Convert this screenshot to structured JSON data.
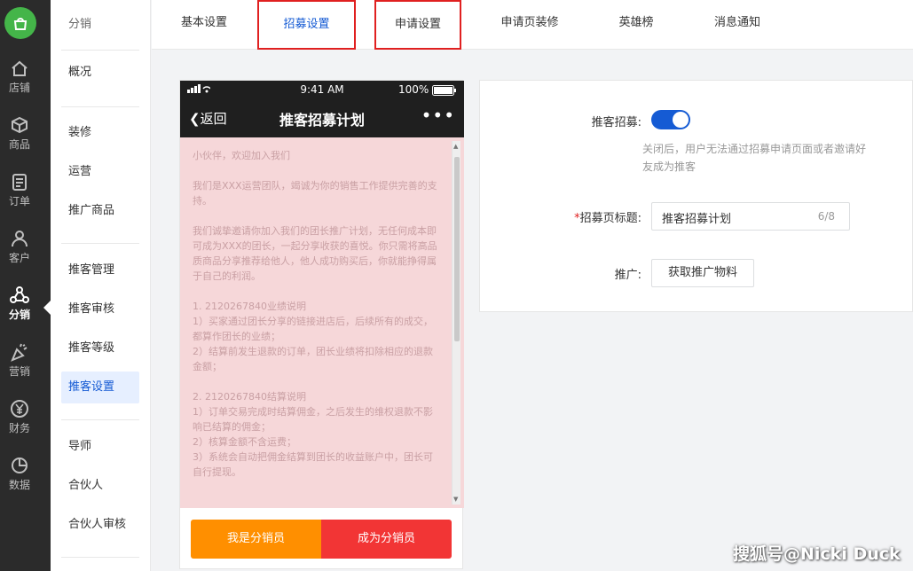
{
  "rail": {
    "items": [
      {
        "label": "店铺",
        "icon": "home-icon"
      },
      {
        "label": "商品",
        "icon": "cube-icon"
      },
      {
        "label": "订单",
        "icon": "order-icon"
      },
      {
        "label": "客户",
        "icon": "user-icon"
      },
      {
        "label": "分销",
        "icon": "distribution-icon"
      },
      {
        "label": "营销",
        "icon": "party-icon"
      },
      {
        "label": "财务",
        "icon": "yen-icon"
      },
      {
        "label": "数据",
        "icon": "pie-chart-icon"
      }
    ],
    "active": "分销"
  },
  "subnav": {
    "title": "分销",
    "items": [
      "概况",
      "装修",
      "运营",
      "推广商品",
      "推客管理",
      "推客审核",
      "推客等级",
      "推客设置",
      "导师",
      "合伙人",
      "合伙人审核"
    ],
    "active": "推客设置"
  },
  "tabs": {
    "items": [
      "基本设置",
      "招募设置",
      "申请设置",
      "申请页装修",
      "英雄榜",
      "消息通知"
    ],
    "active": "招募设置",
    "highlighted": [
      "招募设置",
      "申请设置"
    ]
  },
  "phone": {
    "status_time": "9:41 AM",
    "battery": "100%",
    "back_label": "返回",
    "title": "推客招募计划",
    "more": "•••",
    "paragraphs": [
      "小伙伴，欢迎加入我们",
      "我们是XXX运营团队，竭诚为你的销售工作提供完善的支持。",
      "我们诚挚邀请你加入我们的团长推广计划，无任何成本即可成为XXX的团长，一起分享收获的喜悦。你只需将高品质商品分享推荐给他人，他人成功购买后，你就能挣得属于自己的利润。",
      "1. 2120267840业绩说明\n1）买家通过团长分享的链接进店后，后续所有的成交，都算作团长的业绩；\n2）结算前发生退款的订单，团长业绩将扣除相应的退款金额；",
      "2. 2120267840结算说明\n1）订单交易完成时结算佣金，之后发生的维权退款不影响已结算的佣金；\n2）核算金额不含运费；\n3）系统会自动把佣金结算到团长的收益账户中，团长可自行提现。"
    ],
    "btn_left": "我是分销员",
    "btn_right": "成为分销员"
  },
  "form": {
    "recruit_label": "推客招募:",
    "recruit_enabled": true,
    "hint": "关闭后，用户无法通过招募申请页面或者邀请好友成为推客",
    "title_label": "招募页标题:",
    "title_required": "*",
    "title_value": "推客招募计划",
    "title_count": "6/8",
    "promo_label": "推广:",
    "promo_button": "获取推广物料"
  },
  "watermark": "搜狐号@Nicki Duck",
  "colors": {
    "primary": "#155bd4",
    "rail_bg": "#2b2b2b",
    "logo": "#44b549",
    "orange": "#ff8f00",
    "red": "#f23535",
    "highlight_box": "#e02020"
  }
}
